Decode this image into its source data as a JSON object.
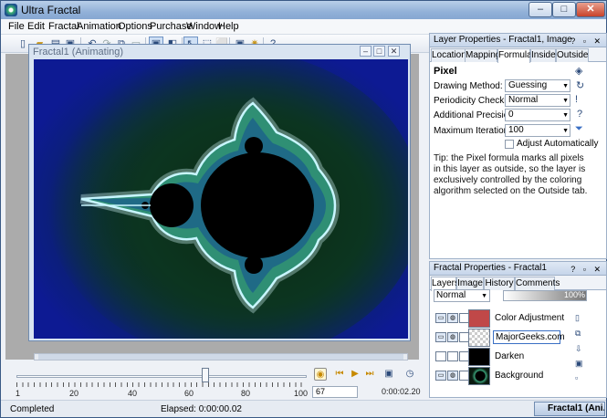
{
  "window": {
    "title": "Ultra Fractal",
    "minimize": "–",
    "maximize": "□",
    "close": "✕"
  },
  "menu": [
    "File",
    "Edit",
    "Fractal",
    "Animation",
    "Options",
    "Purchase",
    "Window",
    "Help"
  ],
  "fractal_window": {
    "title": "Fractal1 (Animating)",
    "min": "–",
    "max": "□",
    "close": "✕"
  },
  "timeline": {
    "position_fraction": 0.65,
    "tick_labels": [
      "1",
      "20",
      "40",
      "60",
      "80",
      "100"
    ],
    "frame": "67",
    "time": "0:00:02.20"
  },
  "status": {
    "left": "Completed",
    "elapsed": "Elapsed: 0:00:00.02",
    "task": "Fractal1 (Ani..."
  },
  "layer_properties": {
    "header": "Layer Properties - Fractal1, Image",
    "tabs": [
      "Location",
      "Mapping",
      "Formula",
      "Inside",
      "Outside"
    ],
    "active_tab": "Formula",
    "section": "Pixel",
    "drawing_method_label": "Drawing Method:",
    "drawing_method": "Guessing",
    "periodicity_label": "Periodicity Checking:",
    "periodicity": "Normal",
    "precision_label": "Additional Precision:",
    "precision": "0",
    "max_iter_label": "Maximum Iterations:",
    "max_iter": "100",
    "adjust_label": "Adjust Automatically",
    "tip": "Tip: the Pixel formula marks all pixels in this layer as outside, so the layer is exclusively controlled by the coloring algorithm selected on the Outside tab."
  },
  "fractal_properties": {
    "header": "Fractal Properties - Fractal1",
    "tabs": [
      "Layers",
      "Image",
      "History",
      "Comments"
    ],
    "active_tab": "Layers",
    "blend_mode": "Normal",
    "opacity": "100%",
    "layers": [
      {
        "name": "Color Adjustment",
        "thumb": "#c04848"
      },
      {
        "name": "MajorGeeks.com",
        "thumb": "checker"
      },
      {
        "name": "Darken",
        "thumb": "#000000"
      },
      {
        "name": "Background",
        "thumb": "fractal"
      }
    ]
  },
  "colors": {
    "accent": "#3a6fc4",
    "fractal_glow": "#9fe6ff",
    "fractal_bg": "#0d1a93"
  }
}
